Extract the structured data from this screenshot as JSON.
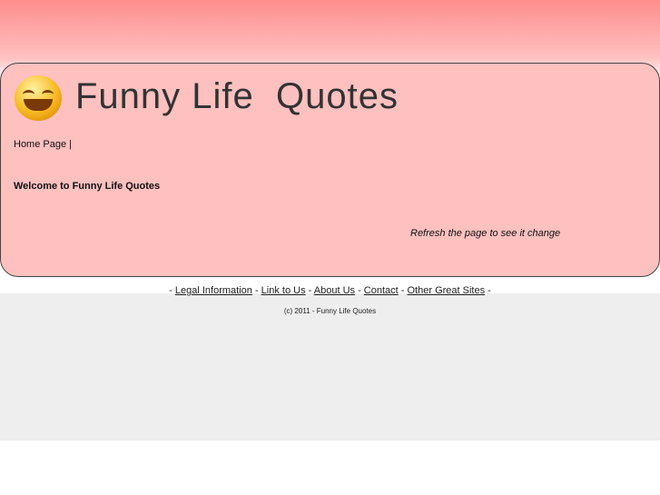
{
  "header": {
    "title": "Funny Life  Quotes",
    "logo_icon": "smiley-face-icon"
  },
  "nav": {
    "home": "Home Page |"
  },
  "main": {
    "welcome": "Welcome to Funny Life Quotes",
    "refresh": "Refresh the page to see it change"
  },
  "footer": {
    "sep": " - ",
    "links": [
      "Legal Information",
      "Link to Us",
      "About Us",
      "Contact",
      "Other Great Sites"
    ],
    "copyright": "(c) 2011 - Funny Life Quotes"
  }
}
